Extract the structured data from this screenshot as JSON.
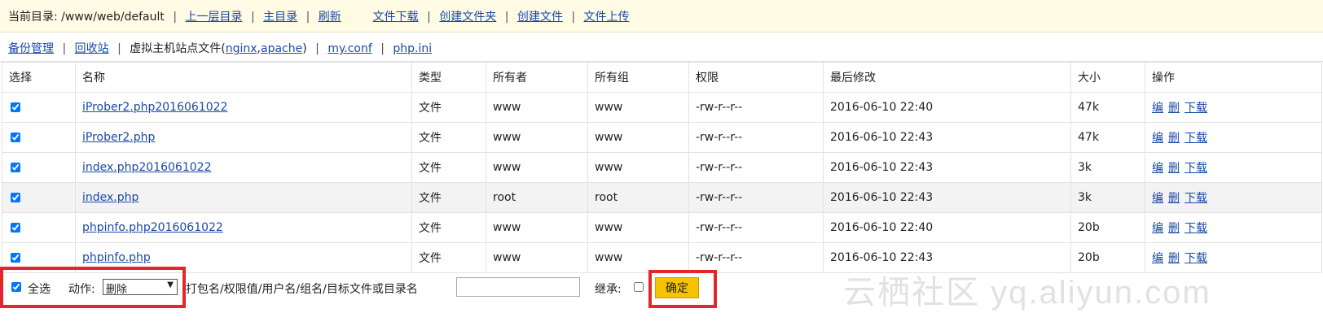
{
  "topbar": {
    "current_dir_label": "当前目录: /www/web/default",
    "links": [
      "上一层目录",
      "主目录",
      "刷新",
      "文件下载",
      "创建文件夹",
      "创建文件",
      "文件上传"
    ]
  },
  "secondbar": {
    "backup": "备份管理",
    "recycle": "回收站",
    "vhost_prefix": "虚拟主机站点文件(",
    "nginx": "nginx",
    "comma": ",",
    "apache": "apache",
    "vhost_suffix": ")",
    "myconf": "my.conf",
    "phpini": "php.ini"
  },
  "table": {
    "headers": [
      "选择",
      "名称",
      "类型",
      "所有者",
      "所有组",
      "权限",
      "最后修改",
      "大小",
      "操作"
    ],
    "rows": [
      {
        "name": "iProber2.php2016061022",
        "type": "文件",
        "owner": "www",
        "group": "www",
        "perm": "-rw-r--r--",
        "mtime": "2016-06-10 22:40",
        "size": "47k"
      },
      {
        "name": "iProber2.php",
        "type": "文件",
        "owner": "www",
        "group": "www",
        "perm": "-rw-r--r--",
        "mtime": "2016-06-10 22:43",
        "size": "47k"
      },
      {
        "name": "index.php2016061022",
        "type": "文件",
        "owner": "www",
        "group": "www",
        "perm": "-rw-r--r--",
        "mtime": "2016-06-10 22:43",
        "size": "3k"
      },
      {
        "name": "index.php",
        "type": "文件",
        "owner": "root",
        "group": "root",
        "perm": "-rw-r--r--",
        "mtime": "2016-06-10 22:43",
        "size": "3k"
      },
      {
        "name": "phpinfo.php2016061022",
        "type": "文件",
        "owner": "www",
        "group": "www",
        "perm": "-rw-r--r--",
        "mtime": "2016-06-10 22:40",
        "size": "20b"
      },
      {
        "name": "phpinfo.php",
        "type": "文件",
        "owner": "www",
        "group": "www",
        "perm": "-rw-r--r--",
        "mtime": "2016-06-10 22:43",
        "size": "20b"
      }
    ],
    "ops": {
      "edit": "编",
      "delete": "删",
      "download": "下载"
    }
  },
  "footer": {
    "select_all": "全选",
    "action_label": "动作:",
    "action_value": "删除",
    "param_label": "打包名/权限值/用户名/组名/目标文件或目录名",
    "inherit_label": "继承:",
    "confirm": "确定"
  },
  "watermark": "云栖社区 yq.aliyun.com",
  "colors": {
    "link": "#1a4aa8",
    "highlight_box": "#e3262b",
    "confirm_button": "#f5c400",
    "topbar_bg": "#fffbe5"
  }
}
